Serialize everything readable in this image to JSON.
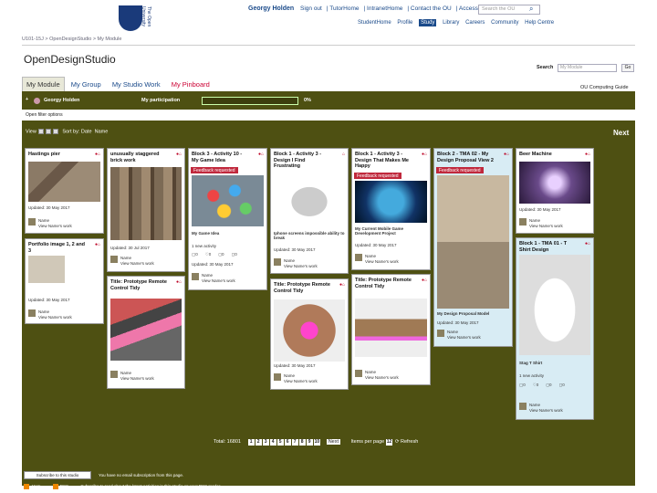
{
  "header": {
    "user": "Georgy Holden",
    "links": [
      "Sign out",
      "TutorHome",
      "IntranetHome",
      "Contact the OU",
      "Accessibility"
    ],
    "search_placeholder": "Search the OU",
    "nav": [
      "StudentHome",
      "Profile",
      "Study",
      "Library",
      "Careers",
      "Community",
      "Help Centre"
    ],
    "logo_text": "The Open University"
  },
  "breadcrumb": "U101-15J > OpenDesignStudio > My Module",
  "title": "OpenDesignStudio",
  "module_search": {
    "label": "Search",
    "placeholder": "My Module",
    "go": "Go"
  },
  "tabs": [
    "My Module",
    "My Group",
    "My Studio Work",
    "My Pinboard"
  ],
  "guide": "OU Computing Guide",
  "participation": {
    "user": "Georgy Holden",
    "label": "My participation",
    "pct": "0%"
  },
  "filters": "Open filter options",
  "view": {
    "label": "View",
    "sort": "Sort by: Date",
    "name": "Name",
    "next": "Next"
  },
  "cards": {
    "c1": {
      "title": "Hastings pier",
      "meta": "Updated: 30 May 2017",
      "name": "Name",
      "view": "View Name's work"
    },
    "c2": {
      "title": "Portfolio image 1, 2 and 3",
      "meta": "Updated: 30 May 2017",
      "name": "Name",
      "view": "View Name's work"
    },
    "c3": {
      "title": "unusually staggered brick work",
      "meta": "Updated: 30 Jul 2017",
      "name": "Name",
      "view": "View Name's work"
    },
    "c4": {
      "title": "Title: Prototype Remote Control Tidy",
      "name": "Name",
      "view": "View Name's work"
    },
    "c5": {
      "title": "Block 3 - Activity 10 - My Game Idea",
      "fb": "Feedback requested",
      "caption": "My Game Idea",
      "act": "1 new activity",
      "meta": "Updated: 30 May 2017",
      "name": "Name",
      "view": "View Name's work"
    },
    "c6": {
      "title": "Block 1 - Activity 3 - Design I Find Frustrating",
      "caption": "Iphone screens impossible ability to break",
      "meta": "Updated: 30 May 2017",
      "name": "Name",
      "view": "View Name's work"
    },
    "c7": {
      "title": "Title: Prototype Remote Control Tidy",
      "meta": "Updated: 30 May 2017",
      "name": "Name",
      "view": "View Name's work"
    },
    "c8": {
      "title": "Block 1 - Activity 3 - Design That Makes Me Happy",
      "fb": "Feedback requested",
      "caption": "My Current Mobile Game Development Project",
      "meta": "Updated: 30 May 2017",
      "name": "Name",
      "view": "View Name's work"
    },
    "c9": {
      "title": "Title: Prototype Remote Control Tidy",
      "name": "Name",
      "view": "View Name's work"
    },
    "c10": {
      "title": "Block 2 - TMA 02 - My Design Proposal View 2",
      "fb": "Feedback requested",
      "caption": "My Design Proposal Model",
      "meta": "Updated: 30 May 2017",
      "name": "Name",
      "view": "View Name's work"
    },
    "c11": {
      "title": "Beer Machine",
      "meta": "Updated: 30 May 2017",
      "name": "Name",
      "view": "View Name's work"
    },
    "c12": {
      "title": "Block 1 - TMA 01 - T Shirt Design",
      "caption": "Stag T Shirt",
      "act": "1 new activity",
      "name": "Name",
      "view": "View Name's work"
    }
  },
  "pager": {
    "total": "Total: 16801",
    "pages": [
      "1",
      "2",
      "3",
      "4",
      "5",
      "6",
      "7",
      "8",
      "9",
      "10"
    ],
    "next": "Next",
    "per_page": "Items per page",
    "per_value": "12",
    "refresh": "Refresh"
  },
  "subscribe": {
    "button": "Subscribe to this studio",
    "note": "You have no email subscription from this page."
  },
  "feeds": {
    "atom": "Atom",
    "rss": "RSS",
    "note": "Subscribe to read about the latest activities in this studio on your RSS reader"
  }
}
